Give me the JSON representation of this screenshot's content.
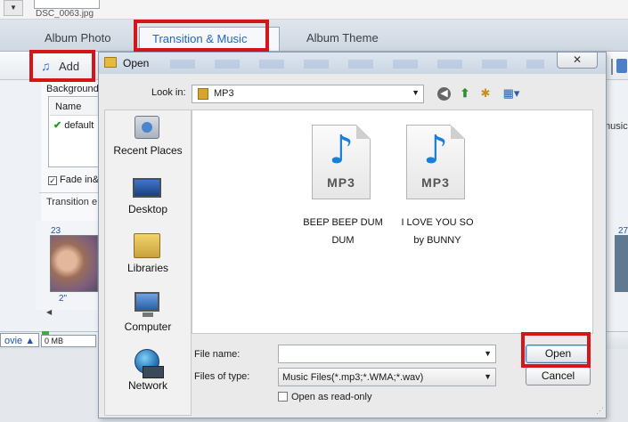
{
  "background_app": {
    "thumb_caption": "DSC_0063.jpg",
    "tabs": [
      {
        "label": "Album Photo"
      },
      {
        "label": "Transition & Music"
      },
      {
        "label": "Album Theme"
      }
    ],
    "add_label": "Add",
    "background_label": "Background",
    "list_header": "Name",
    "list_item": "default",
    "fade_label": "Fade in&",
    "transition_label": "Transition e",
    "film_number": "23",
    "film_duration": "2\"",
    "right_text": "music",
    "right_film_number": "27",
    "status_movie": "ovie",
    "status_size": "0 MB"
  },
  "dialog": {
    "title": "Open",
    "look_in_label": "Look in:",
    "look_in_value": "MP3",
    "places": [
      {
        "label": "Recent Places",
        "icon": "recent-places-icon"
      },
      {
        "label": "Desktop",
        "icon": "desktop-icon"
      },
      {
        "label": "Libraries",
        "icon": "libraries-icon"
      },
      {
        "label": "Computer",
        "icon": "computer-icon"
      },
      {
        "label": "Network",
        "icon": "network-icon"
      }
    ],
    "files": [
      {
        "badge": "MP3",
        "name_line1": "BEEP BEEP DUM",
        "name_line2": "DUM"
      },
      {
        "badge": "MP3",
        "name_line1": "I LOVE YOU SO",
        "name_line2": "by BUNNY"
      }
    ],
    "file_name_label": "File name:",
    "file_name_value": "",
    "files_of_type_label": "Files of type:",
    "files_of_type_value": "Music Files(*.mp3;*.WMA;*.wav)",
    "readonly_label": "Open as read-only",
    "open_label": "Open",
    "cancel_label": "Cancel",
    "close_glyph": "✕"
  },
  "colors": {
    "highlight": "#d6151b",
    "active_tab_text": "#2267c9",
    "mp3_note": "#1a7fd8"
  }
}
